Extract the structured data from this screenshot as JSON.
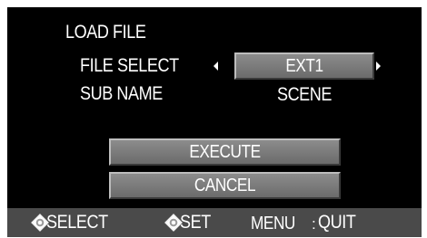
{
  "dialog": {
    "title": "LOAD FILE",
    "file_select": {
      "label": "FILE SELECT",
      "value": "EXT1"
    },
    "sub_name": {
      "label": "SUB NAME",
      "value": "SCENE"
    },
    "buttons": {
      "execute": "EXECUTE",
      "cancel": "CANCEL"
    }
  },
  "footer": {
    "select_label": "SELECT",
    "set_label": "SET",
    "menu_label": "MENU",
    "separator": ":",
    "quit_label": "QUIT",
    "icons": [
      "dpad-icon",
      "dpad-icon"
    ]
  },
  "colors": {
    "background": "#000000",
    "text": "#ffffff",
    "button": "#7a7a7a",
    "footer": "#4a4a4a"
  }
}
